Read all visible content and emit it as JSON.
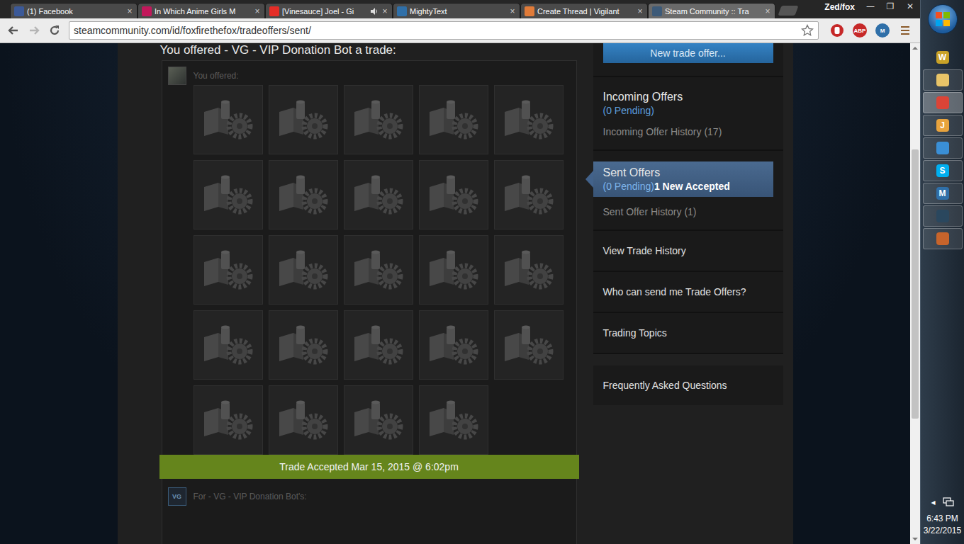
{
  "browser": {
    "profile": "Zed/fox",
    "window_controls": [
      "—",
      "❐",
      "✕"
    ],
    "tab_close": "×",
    "tabs": [
      {
        "title": "(1) Facebook",
        "selected": false,
        "audio": false,
        "color": "#3b5998"
      },
      {
        "title": "In Which Anime Girls M",
        "selected": false,
        "audio": false,
        "color": "#c2185b"
      },
      {
        "title": "[Vinesauce] Joel - Gi",
        "selected": false,
        "audio": true,
        "color": "#e52d27"
      },
      {
        "title": "MightyText",
        "selected": false,
        "audio": false,
        "color": "#2f6fa8"
      },
      {
        "title": "Create Thread | Vigilant",
        "selected": false,
        "audio": false,
        "color": "#e07b39"
      },
      {
        "title": "Steam Community :: Tra",
        "selected": true,
        "audio": false,
        "color": "#3d5a78"
      }
    ],
    "url": "steamcommunity.com/id/foxfirethefox/tradeoffers/sent/",
    "extensions": [
      {
        "kind": "stop",
        "label": "",
        "color": "#c62828"
      },
      {
        "kind": "badge",
        "label": "ABP",
        "color": "#c62828"
      },
      {
        "kind": "badge",
        "label": "M",
        "color": "#2f6fa8"
      }
    ]
  },
  "trade": {
    "heading": "You offered - VG - VIP Donation Bot a trade:",
    "you_offered": "You offered:",
    "items": [
      {
        "dimmed": true
      },
      {
        "dimmed": true
      },
      {
        "dimmed": true
      },
      {
        "dimmed": true
      },
      {
        "dimmed": true
      },
      {
        "dimmed": true
      },
      {
        "dimmed": true
      },
      {
        "dimmed": true
      },
      {
        "dimmed": true
      },
      {
        "dimmed": true
      },
      {
        "dimmed": true
      },
      {
        "dimmed": true
      },
      {
        "dimmed": true
      },
      {
        "dimmed": true
      },
      {
        "dimmed": true
      },
      {
        "dimmed": true
      },
      {
        "dimmed": true
      },
      {
        "dimmed": true
      },
      {
        "dimmed": true
      },
      {
        "dimmed": true
      },
      {
        "dimmed": true
      },
      {
        "dimmed": true
      },
      {
        "dimmed": true
      },
      {
        "dimmed": true
      }
    ],
    "status": "Trade Accepted Mar 15, 2015 @ 6:02pm",
    "partner_avatar": "VG",
    "for_label": "For - VG - VIP Donation Bot's:"
  },
  "sidebar": {
    "new_offer_button": "New trade offer...",
    "sections": [
      {
        "title": "Incoming Offers",
        "pending": "(0 Pending)",
        "note": "",
        "history": "Incoming Offer History (17)",
        "selected": false
      },
      {
        "title": "Sent Offers",
        "pending": "(0 Pending)",
        "note": "1 New Accepted",
        "history": "Sent Offer History (1)",
        "selected": true
      }
    ],
    "links": [
      "View Trade History",
      "Who can send me Trade Offers?",
      "Trading Topics"
    ],
    "faq": "Frequently Asked Questions"
  },
  "taskbar": {
    "apps": [
      {
        "glyph": "W",
        "color": "#c9a227",
        "running": false,
        "active": false
      },
      {
        "glyph": "",
        "color": "#e8c468",
        "running": true,
        "active": false
      },
      {
        "glyph": "",
        "color": "#db4437",
        "running": true,
        "active": true
      },
      {
        "glyph": "J",
        "color": "#e8a33d",
        "running": true,
        "active": false
      },
      {
        "glyph": "",
        "color": "#3a8fd6",
        "running": true,
        "active": false
      },
      {
        "glyph": "S",
        "color": "#00aff0",
        "running": true,
        "active": false
      },
      {
        "glyph": "M",
        "color": "#2f6fa8",
        "running": true,
        "active": false
      },
      {
        "glyph": "",
        "color": "#2a475e",
        "running": true,
        "active": false
      },
      {
        "glyph": "",
        "color": "#c7642b",
        "running": true,
        "active": false
      }
    ],
    "tray_arrow": "◂",
    "time": "6:43 PM",
    "date": "3/22/2015"
  }
}
